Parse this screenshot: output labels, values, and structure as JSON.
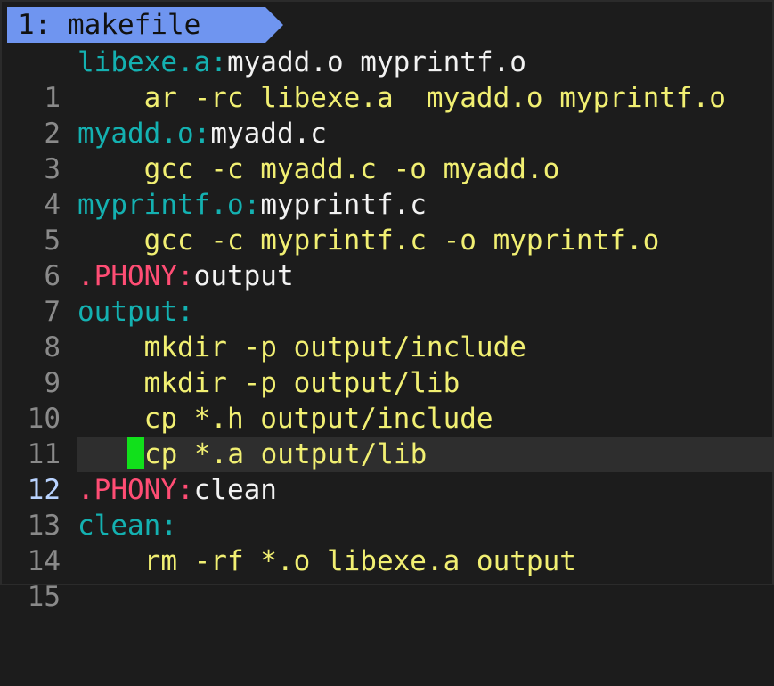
{
  "tab": {
    "label": "1: makefile"
  },
  "colors": {
    "background": "#1c1c1c",
    "tab_bg": "#6f95f0",
    "target": "#14b1b1",
    "command": "#f1ef72",
    "phony": "#ff4d74",
    "cursor": "#11e01b"
  },
  "lines": [
    {
      "num": "1",
      "target": "libexe.a:",
      "deps": "myadd.o myprintf.o"
    },
    {
      "num": "2",
      "indent": "    ",
      "command": "ar -rc libexe.a  myadd.o myprintf.o"
    },
    {
      "num": "3",
      "target": "myadd.o:",
      "deps": "myadd.c"
    },
    {
      "num": "4",
      "indent": "    ",
      "command": "gcc -c myadd.c -o myadd.o"
    },
    {
      "num": "5",
      "target": "myprintf.o:",
      "deps": "myprintf.c"
    },
    {
      "num": "6",
      "indent": "    ",
      "command": "gcc -c myprintf.c -o myprintf.o"
    },
    {
      "num": "7",
      "phony": ".PHONY:",
      "deps": "output"
    },
    {
      "num": "8",
      "target": "output:"
    },
    {
      "num": "9",
      "indent": "    ",
      "command": "mkdir -p output/include"
    },
    {
      "num": "10",
      "indent": "    ",
      "command": "mkdir -p output/lib"
    },
    {
      "num": "11",
      "indent": "    ",
      "command": "cp *.h output/include"
    },
    {
      "num": "12",
      "indent": "   ",
      "command": "cp *.a output/lib",
      "current": true
    },
    {
      "num": "13",
      "phony": ".PHONY:",
      "deps": "clean"
    },
    {
      "num": "14",
      "target": "clean:"
    },
    {
      "num": "15",
      "indent": "    ",
      "command": "rm -rf *.o libexe.a output"
    }
  ]
}
